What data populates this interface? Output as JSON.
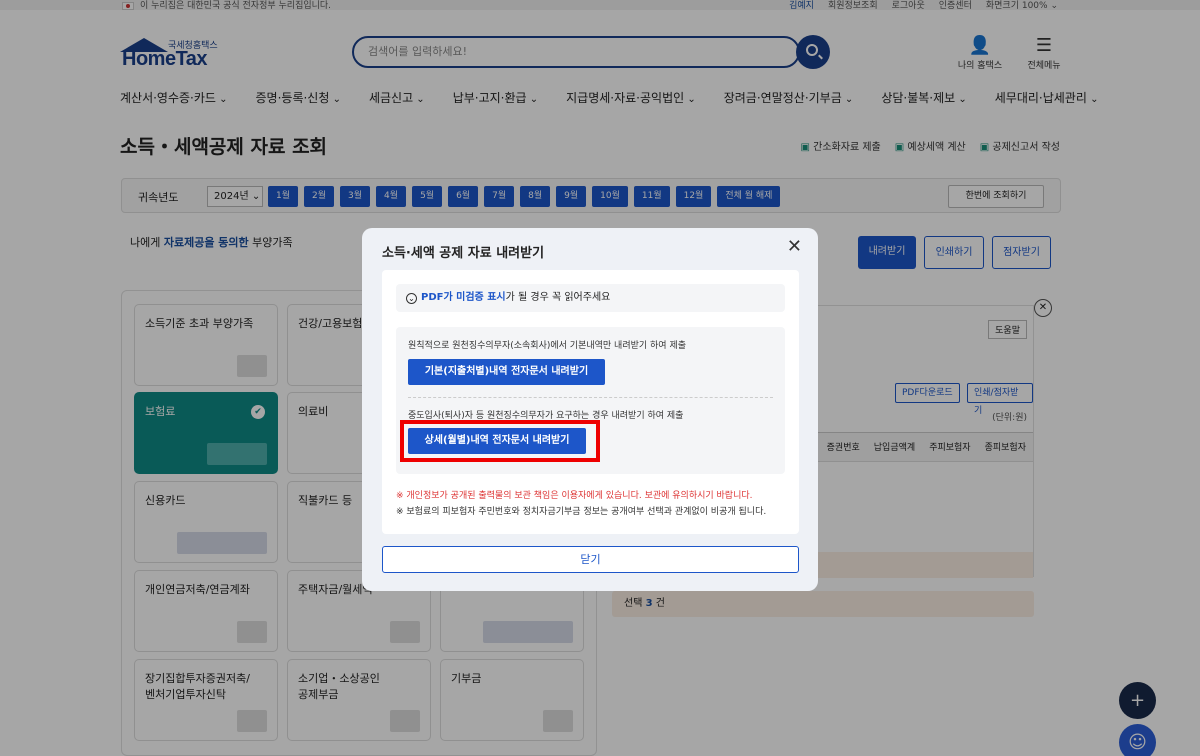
{
  "util": {
    "notice": "이 누리집은 대한민국 공식 전자정부 누리집입니다.",
    "links": [
      "김예지",
      "회원정보조회",
      "로그아웃",
      "인증센터",
      "화면크기 100% ⌄"
    ]
  },
  "header": {
    "logo_small": "국세청홈택스",
    "logo_big": "HomeTax",
    "search_placeholder": "검색어를 입력하세요!",
    "my_hometax": "나의 홈택스",
    "all_menu": "전체메뉴"
  },
  "nav": [
    "계산서·영수증·카드",
    "증명·등록·신청",
    "세금신고",
    "납부·고지·환급",
    "지급명세·자료·공익법인",
    "장려금·연말정산·기부금",
    "상담·불복·제보",
    "세무대리·납세관리"
  ],
  "page": {
    "title": "소득・세액공제 자료 조회",
    "actions": [
      "간소화자료 제출",
      "예상세액 계산",
      "공제신고서 작성"
    ],
    "year_label": "귀속년도",
    "year_value": "2024년 ⌄",
    "months": [
      "1월",
      "2월",
      "3월",
      "4월",
      "5월",
      "6월",
      "7월",
      "8월",
      "9월",
      "10월",
      "11월",
      "12월",
      "전체 월 해제"
    ],
    "once_btn": "한번에 조회하기",
    "consent_pre": "나에게 ",
    "consent_hl": "자료제공을 동의한",
    "consent_post": " 부양가족",
    "download": "내려받기",
    "print": "인쇄하기",
    "braille": "점자받기"
  },
  "cards": [
    "소득기준 초과 부양가족",
    "건강/고용보험",
    "보험료",
    "의료비",
    "신용카드",
    "직불카드 등",
    "개인연금저축/연금계좌",
    "주택자금/월세액",
    "장기집합투자증권저축/\n벤처기업투자신탁",
    "소기업・소상공인\n공제부금",
    "기부금"
  ],
  "right_panel": {
    "help": "도움말",
    "pdf_download": "PDF다운로드",
    "print_braille": "인쇄/점자받기",
    "unit": "(단위:원)",
    "columns": [
      "증권번호",
      "납입금액계",
      "주피보험자",
      "종피보험자"
    ],
    "select_pre": "선택 ",
    "select_count": "3",
    "select_post": " 건"
  },
  "modal": {
    "title": "소득·세액 공제 자료 내려받기",
    "close_icon": "✕",
    "pdf_note_hl": "PDF가 미검증 표시",
    "pdf_note_rest": "가 될 경우 꼭 읽어주세요",
    "desc1": "원칙적으로 원천징수의무자(소속회사)에서 기본내역만 내려받기 하여 제출",
    "btn1": "기본(지출처별)내역 전자문서 내려받기",
    "desc2": "중도입사(퇴사)자 등 원천징수의무자가 요구하는 경우 내려받기 하여 제출",
    "btn2": "상세(월별)내역 전자문서 내려받기",
    "warn1": "※ 개인정보가 공개된 출력물의 보관 책임은 이용자에게 있습니다. 보관에 유의하시기 바랍니다.",
    "warn2": "※ 보험료의 피보험자 주민번호와 정치자금기부금 정보는 공개여부 선택과 관계없이 비공개 됩니다.",
    "close": "닫기"
  },
  "colors": {
    "primary": "#1d56c9",
    "brand": "#1a3f8a",
    "active_card": "#0f8a86",
    "highlight_frame": "#e00000"
  }
}
